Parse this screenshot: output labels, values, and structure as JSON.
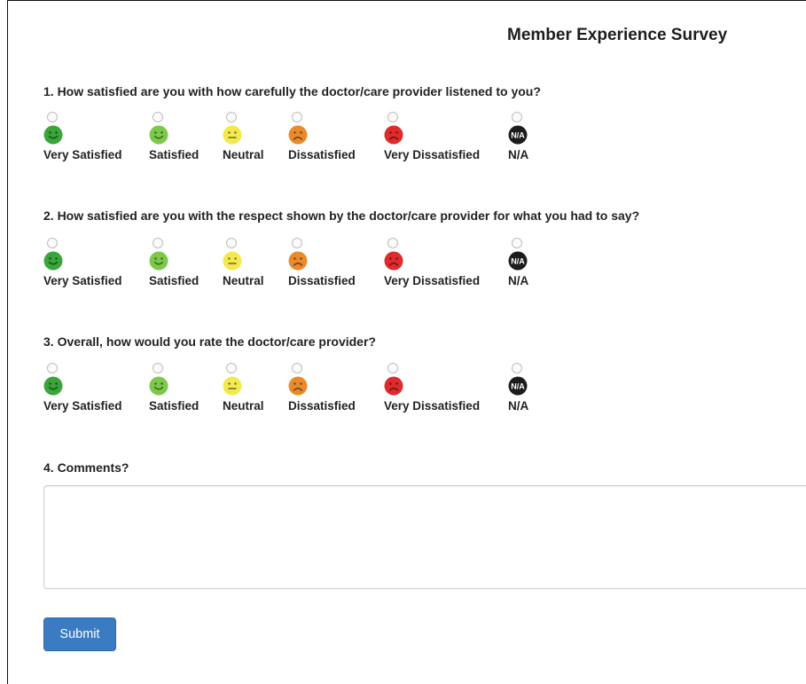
{
  "title": "Member Experience Survey",
  "rating_options": [
    {
      "label": "Very Satisfied",
      "icon": "very-satisfied-face-icon",
      "color": "#3aa53a"
    },
    {
      "label": "Satisfied",
      "icon": "satisfied-face-icon",
      "color": "#7cc94a"
    },
    {
      "label": "Neutral",
      "icon": "neutral-face-icon",
      "color": "#f2e94e"
    },
    {
      "label": "Dissatisfied",
      "icon": "dissatisfied-face-icon",
      "color": "#e98a2c"
    },
    {
      "label": "Very Dissatisfied",
      "icon": "very-dissatisfied-face-icon",
      "color": "#df2b2b"
    },
    {
      "label": "N/A",
      "icon": "na-badge-icon",
      "color": "#1c1c1c",
      "badge_text": "N/A"
    }
  ],
  "questions": [
    {
      "text": "1. How satisfied are you with how carefully the doctor/care provider listened to you?"
    },
    {
      "text": "2. How satisfied are you with the respect shown by the doctor/care provider for what you had to say?"
    },
    {
      "text": "3. Overall, how would you rate the doctor/care provider?"
    }
  ],
  "comments": {
    "label": "4. Comments?",
    "value": "",
    "placeholder": ""
  },
  "submit_label": "Submit",
  "colors": {
    "accent": "#3a7bc2"
  }
}
